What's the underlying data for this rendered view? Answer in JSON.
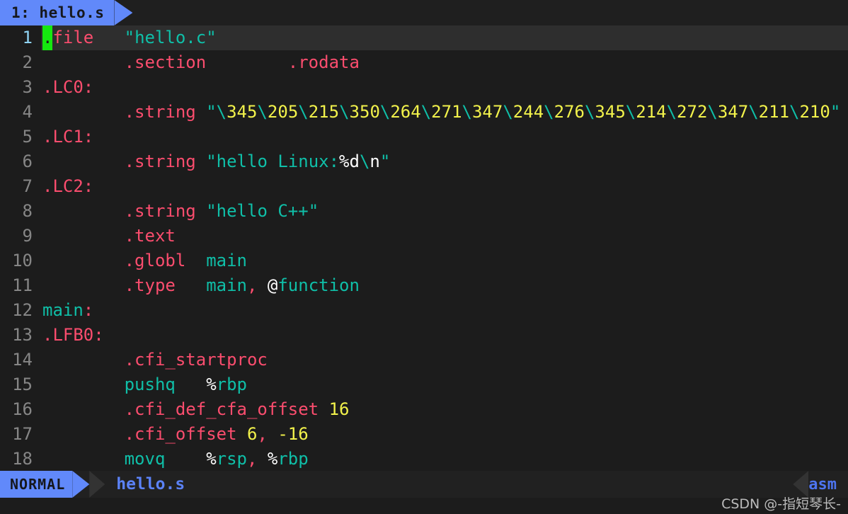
{
  "tabline": {
    "tabs": [
      {
        "label": "1: hello.s",
        "active": true
      }
    ]
  },
  "editor": {
    "filetype": "asm",
    "cursor_line": 1,
    "cursor_char": ".",
    "lines": [
      {
        "num": "1",
        "text": ".file\t\"hello.c\""
      },
      {
        "num": "2",
        "text": "\t.section\t.rodata"
      },
      {
        "num": "3",
        "text": ".LC0:"
      },
      {
        "num": "4",
        "text": "\t.string \"\\345\\205\\215\\350\\264\\271\\347\\244\\276\\345\\214\\272\\347\\211\\210\""
      },
      {
        "num": "5",
        "text": ".LC1:"
      },
      {
        "num": "6",
        "text": "\t.string \"hello Linux:%d\\n\""
      },
      {
        "num": "7",
        "text": ".LC2:"
      },
      {
        "num": "8",
        "text": "\t.string \"hello C++\""
      },
      {
        "num": "9",
        "text": "\t.text"
      },
      {
        "num": "10",
        "text": "\t.globl\tmain"
      },
      {
        "num": "11",
        "text": "\t.type\tmain, @function"
      },
      {
        "num": "12",
        "text": "main:"
      },
      {
        "num": "13",
        "text": ".LFB0:"
      },
      {
        "num": "14",
        "text": "\t.cfi_startproc"
      },
      {
        "num": "15",
        "text": "\tpushq\t%rbp"
      },
      {
        "num": "16",
        "text": "\t.cfi_def_cfa_offset 16"
      },
      {
        "num": "17",
        "text": "\t.cfi_offset 6, -16"
      },
      {
        "num": "18",
        "text": "\tmovq\t%rsp, %rbp"
      }
    ]
  },
  "statusline": {
    "mode": "NORMAL",
    "filename": "hello.s",
    "filetype": "asm"
  },
  "watermark": "CSDN @-指短琴长-",
  "colors": {
    "background": "#1c1c1c",
    "cursorline": "#2e2e2e",
    "accent_blue": "#6189fa",
    "directive_pink": "#fb4d6e",
    "string_teal": "#0fbfa8",
    "number_yellow": "#f2f24b",
    "cursor_green": "#15e80f",
    "linenr_gray": "#868686",
    "cursor_linenr": "#8fd3f4"
  }
}
